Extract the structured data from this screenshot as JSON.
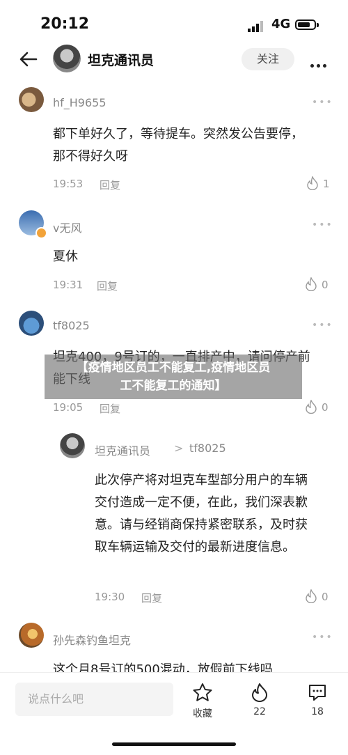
{
  "status_bar": {
    "time": "20:12",
    "network": "4G"
  },
  "header": {
    "title": "坦克通讯员",
    "follow_label": "关注"
  },
  "comments": [
    {
      "user": "hf_H9655",
      "text": "都下单好久了，等待提车。突然发公告要停，那不得好久呀",
      "time": "19:53",
      "reply": "回复",
      "likes": "1"
    },
    {
      "user": "v无风",
      "text": "夏休",
      "time": "19:31",
      "reply": "回复",
      "likes": "0"
    },
    {
      "user": "tf8025",
      "text": "坦克400，9号订的，一直排产中，请问停产前能下线",
      "time": "19:05",
      "reply": "回复",
      "likes": "0"
    },
    {
      "user": "坦克通讯员",
      "reply_to": "tf8025",
      "arrow": ">",
      "text": "此次停产将对坦克车型部分用户的车辆交付造成一定不便，在此，我们深表歉意。请与经销商保持紧密联系，及时获取车辆运输及交付的最新进度信息。",
      "time": "19:30",
      "reply": "回复",
      "likes": "0"
    },
    {
      "user": "孙先森钓鱼坦克",
      "text": "这个月8号订的500混动，放假前下线吗"
    }
  ],
  "banner": {
    "line1": "【疫情地区员工不能复工,疫情地区员",
    "line2": "工不能复工的通知】"
  },
  "bottom_bar": {
    "input_placeholder": "说点什么吧",
    "favorite_label": "收藏",
    "like_count": "22",
    "comment_count": "18"
  }
}
